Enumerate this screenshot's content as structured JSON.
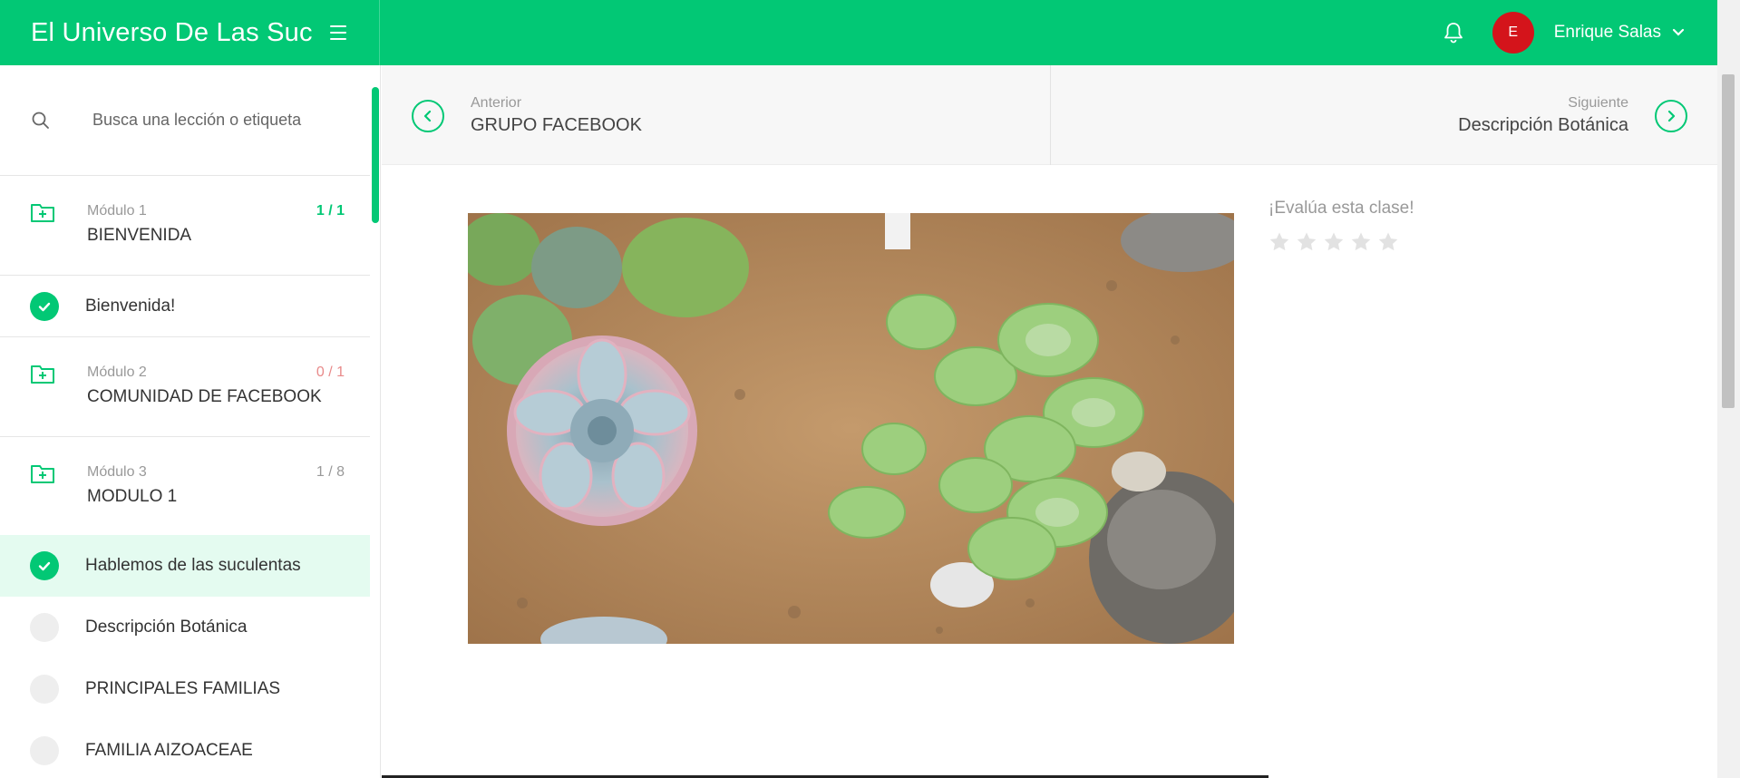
{
  "header": {
    "title": "El Universo De Las Suc",
    "user_name": "Enrique Salas",
    "avatar_initial": "E",
    "brand_color": "#02c875",
    "avatar_color": "#d4141b"
  },
  "sidebar": {
    "search_placeholder": "Busca una lección o etiqueta",
    "modules": [
      {
        "label": "Módulo 1",
        "title": "BIENVENIDA",
        "count": "1 / 1",
        "count_color": "#02c875",
        "lessons": [
          {
            "title": "Bienvenida!",
            "done": true
          }
        ]
      },
      {
        "label": "Módulo 2",
        "title": "COMUNIDAD DE FACEBOOK",
        "count": "0 / 1",
        "count_color": "#e88a8a",
        "lessons": []
      },
      {
        "label": "Módulo 3",
        "title": "MODULO 1",
        "count": "1 / 8",
        "count_color": "#999999",
        "lessons": [
          {
            "title": "Hablemos de las suculentas",
            "done": true,
            "active": true
          },
          {
            "title": "Descripción Botánica",
            "done": false
          },
          {
            "title": "PRINCIPALES FAMILIAS",
            "done": false
          },
          {
            "title": "FAMILIA AIZOACEAE",
            "done": false
          }
        ]
      }
    ]
  },
  "nav": {
    "prev_label": "Anterior",
    "prev_title": "GRUPO FACEBOOK",
    "next_label": "Siguiente",
    "next_title": "Descripción Botánica"
  },
  "rating": {
    "label": "¡Evalúa esta clase!",
    "stars": 5,
    "value": 0
  },
  "icons": [
    "menu-icon",
    "bell-icon",
    "chevron-down-icon",
    "search-icon",
    "folder-plus-icon",
    "check-icon",
    "chevron-left-icon",
    "chevron-right-icon",
    "star-icon"
  ]
}
